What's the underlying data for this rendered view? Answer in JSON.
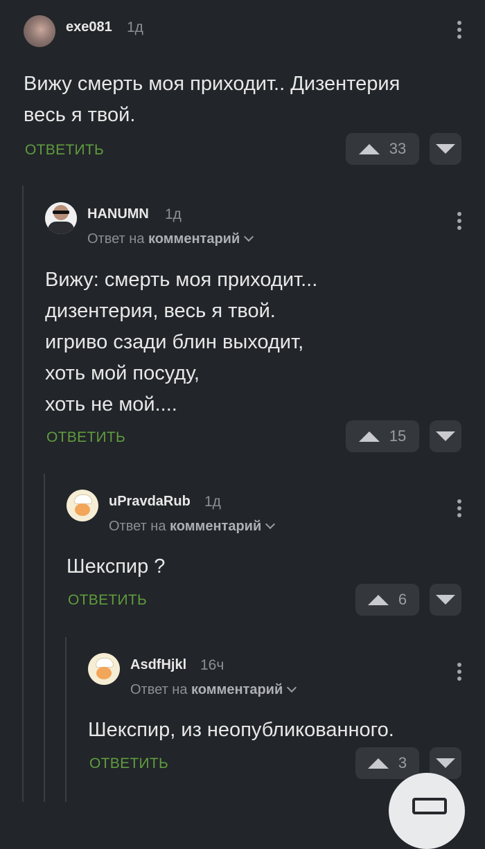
{
  "comments": [
    {
      "username": "exe081",
      "time": "1д",
      "reply_prefix": "",
      "reply_target": "",
      "text_lines": [
        "Вижу смерть моя приходит.. Дизентерия",
        "весь я твой."
      ],
      "reply_label": "ОТВЕТИТЬ",
      "votes": "33",
      "avatar": "blurred-face-avatar"
    },
    {
      "username": "HANUMN",
      "time": "1д",
      "reply_prefix": "Ответ на",
      "reply_target": "комментарий",
      "text_lines": [
        "Вижу: смерть моя приходит...",
        "дизентерия, весь я твой.",
        "игриво сзади блин выходит,",
        "хоть мой посуду,",
        "хоть не мой...."
      ],
      "reply_label": "ОТВЕТИТЬ",
      "votes": "15",
      "avatar": "man-in-sunglasses-avatar"
    },
    {
      "username": "uPravdaRub",
      "time": "1д",
      "reply_prefix": "Ответ на",
      "reply_target": "комментарий",
      "text_lines": [
        "Шекспир ?"
      ],
      "reply_label": "ОТВЕТИТЬ",
      "votes": "6",
      "avatar": "default-chef-avatar"
    },
    {
      "username": "AsdfHjkl",
      "time": "16ч",
      "reply_prefix": "Ответ на",
      "reply_target": "комментарий",
      "text_lines": [
        "Шекспир, из неопубликованного."
      ],
      "reply_label": "ОТВЕТИТЬ",
      "votes": "3",
      "avatar": "default-chef-avatar"
    }
  ],
  "colors": {
    "background": "#222529",
    "reply_link": "#5f9c3f",
    "vote_button": "#34373c",
    "thread_line": "#3a3d42"
  },
  "fab": {
    "icon": "comment-icon"
  }
}
